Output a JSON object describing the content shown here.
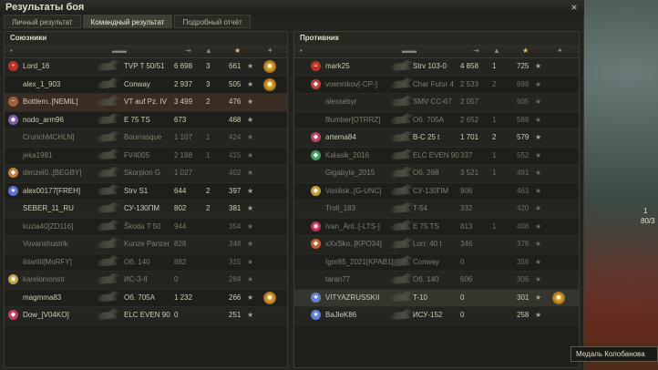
{
  "window": {
    "title": "Результаты боя",
    "close": "×"
  },
  "tabs": [
    {
      "label": "Личный результат",
      "active": false
    },
    {
      "label": "Командный результат",
      "active": true
    },
    {
      "label": "Подробный отчёт",
      "active": false
    }
  ],
  "allies": {
    "header": "Союзники",
    "rows": [
      {
        "name": "Lord_16",
        "badge": "+",
        "tank": "TVP T 50/51",
        "dmg": "6 698",
        "kills": "3",
        "xp": "661",
        "medal": true,
        "state": "alive",
        "badge_color": "#c03020"
      },
      {
        "name": "alex_1_903",
        "badge": "",
        "tank": "Conway",
        "dmg": "2 937",
        "kills": "3",
        "xp": "505",
        "medal": true,
        "state": "alive"
      },
      {
        "name": "Bottlem..[NEMIL]",
        "badge": "~",
        "tank": "VT auf Pz. IV",
        "dmg": "3 499",
        "kills": "2",
        "xp": "476",
        "medal": false,
        "state": "me",
        "badge_color": "#a06040"
      },
      {
        "name": "nodo_arm96",
        "badge": "◆",
        "tank": "E 75 TS",
        "dmg": "673",
        "kills": "",
        "xp": "468",
        "medal": false,
        "state": "alive",
        "badge_color": "#8060b0"
      },
      {
        "name": "CrunchMCHLN]",
        "badge": "",
        "tank": "Bourrasque",
        "dmg": "1 107",
        "kills": "1",
        "xp": "424",
        "medal": false,
        "state": "dead"
      },
      {
        "name": "jeka1981",
        "badge": "",
        "tank": "FV4005",
        "dmg": "2 188",
        "kills": "1",
        "xp": "415",
        "medal": false,
        "state": "dead"
      },
      {
        "name": "denzel0..[BEGBY]",
        "badge": "◆",
        "tank": "Skorpion G",
        "dmg": "1 027",
        "kills": "",
        "xp": "402",
        "medal": false,
        "state": "dead",
        "badge_color": "#c08040"
      },
      {
        "name": "alex00177[FREH]",
        "badge": "★",
        "tank": "Strv S1",
        "dmg": "644",
        "kills": "2",
        "xp": "397",
        "medal": false,
        "state": "alive",
        "badge_color": "#6070d0"
      },
      {
        "name": "SEBER_11_RU",
        "badge": "",
        "tank": "СУ-130ПМ",
        "dmg": "802",
        "kills": "2",
        "xp": "381",
        "medal": false,
        "state": "alive"
      },
      {
        "name": "kuzia40[ZD116]",
        "badge": "",
        "tank": "Škoda T 50",
        "dmg": "944",
        "kills": "",
        "xp": "354",
        "medal": false,
        "state": "dead"
      },
      {
        "name": "Vovanshustrik",
        "badge": "",
        "tank": "Kunze Panzer",
        "dmg": "828",
        "kills": "",
        "xp": "348",
        "medal": false,
        "state": "dead"
      },
      {
        "name": "ildarlili[MoRFY]",
        "badge": "",
        "tank": "Об. 140",
        "dmg": "882",
        "kills": "",
        "xp": "315",
        "medal": false,
        "state": "dead"
      },
      {
        "name": "karelomonstr",
        "badge": "◉",
        "tank": "ИС-3-II",
        "dmg": "0",
        "kills": "",
        "xp": "284",
        "medal": false,
        "state": "dead",
        "badge_color": "#c0a040"
      },
      {
        "name": "magmma83",
        "badge": "",
        "tank": "Об. 705А",
        "dmg": "1 232",
        "kills": "",
        "xp": "266",
        "medal": true,
        "state": "alive"
      },
      {
        "name": "Dow_[V04KO]",
        "badge": "◆",
        "tank": "ELC EVEN 90",
        "dmg": "0",
        "kills": "",
        "xp": "251",
        "medal": false,
        "state": "alive",
        "badge_color": "#c04060"
      }
    ]
  },
  "enemies": {
    "header": "Противник",
    "rows": [
      {
        "name": "mark25",
        "badge": "≈",
        "tank": "Strv 103-0",
        "dmg": "4 858",
        "kills": "1",
        "xp": "725",
        "medal": false,
        "state": "alive",
        "badge_color": "#c03020"
      },
      {
        "name": "voennikov[-CP-]",
        "badge": "◆",
        "tank": "Char Futur 4",
        "dmg": "2 533",
        "kills": "2",
        "xp": "698",
        "medal": false,
        "state": "dead",
        "badge_color": "#c04040"
      },
      {
        "name": "alexsebyr",
        "badge": "",
        "tank": "SMV CC-67",
        "dmg": "2 057",
        "kills": "",
        "xp": "605",
        "medal": false,
        "state": "dead"
      },
      {
        "name": "fliumber[OTRRZ]",
        "badge": "",
        "tank": "Об. 705А",
        "dmg": "2 652",
        "kills": "1",
        "xp": "588",
        "medal": false,
        "state": "dead"
      },
      {
        "name": "artema84",
        "badge": "◆",
        "tank": "B-C 25 t",
        "dmg": "1 701",
        "kills": "2",
        "xp": "579",
        "medal": false,
        "state": "alive",
        "badge_color": "#c04060"
      },
      {
        "name": "Kalasik_2016",
        "badge": "◆",
        "tank": "ELC EVEN 90",
        "dmg": "337",
        "kills": "1",
        "xp": "552",
        "medal": false,
        "state": "dead",
        "badge_color": "#40a060"
      },
      {
        "name": "Gigabyte_2015",
        "badge": "",
        "tank": "Об. 268",
        "dmg": "3 521",
        "kills": "1",
        "xp": "491",
        "medal": false,
        "state": "dead"
      },
      {
        "name": "Vasilisk..[G-UNC]",
        "badge": "◆",
        "tank": "СУ-130ПМ",
        "dmg": "906",
        "kills": "",
        "xp": "463",
        "medal": false,
        "state": "dead",
        "badge_color": "#c0a040"
      },
      {
        "name": "Troll_183",
        "badge": "",
        "tank": "T-54",
        "dmg": "332",
        "kills": "",
        "xp": "420",
        "medal": false,
        "state": "dead"
      },
      {
        "name": "Ivan_Ant..[-LTS-]",
        "badge": "◉",
        "tank": "E 75 TS",
        "dmg": "813",
        "kills": "1",
        "xp": "406",
        "medal": false,
        "state": "dead",
        "badge_color": "#c03050"
      },
      {
        "name": "xXxSko..[KPO34]",
        "badge": "◆",
        "tank": "Lorr. 40 t",
        "dmg": "346",
        "kills": "",
        "xp": "378",
        "medal": false,
        "state": "dead",
        "badge_color": "#c06030"
      },
      {
        "name": "Igor85_2021[KPAB1]",
        "badge": "",
        "tank": "Conway",
        "dmg": "0",
        "kills": "",
        "xp": "356",
        "medal": false,
        "state": "dead"
      },
      {
        "name": "taran77",
        "badge": "",
        "tank": "Об. 140",
        "dmg": "606",
        "kills": "",
        "xp": "306",
        "medal": false,
        "state": "dead"
      },
      {
        "name": "VITYAZRUSSKII",
        "badge": "★",
        "tank": "T-10",
        "dmg": "0",
        "kills": "",
        "xp": "301",
        "medal": true,
        "state": "hl",
        "badge_color": "#6080d0"
      },
      {
        "name": "BaJleK86",
        "badge": "★",
        "tank": "ИСУ-152",
        "dmg": "0",
        "kills": "",
        "xp": "258",
        "medal": false,
        "state": "alive",
        "badge_color": "#6080d0"
      }
    ]
  },
  "tooltip": "Медаль Колобанова",
  "side": {
    "a": "1",
    "b": "80/3"
  },
  "colors": {
    "medal": "#d8a838",
    "active_tab": "#3e3f36",
    "me_row": "#3a2c22"
  }
}
